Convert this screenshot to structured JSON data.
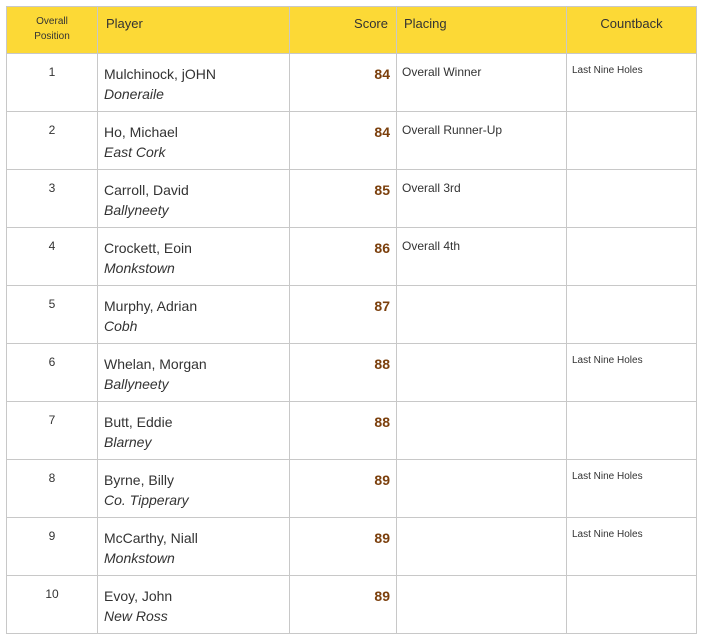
{
  "header": {
    "overall_line1": "Overall",
    "overall_line2": "Position",
    "player": "Player",
    "score": "Score",
    "placing": "Placing",
    "countback": "Countback"
  },
  "colors": {
    "header_bg": "#fcd936",
    "score_text": "#7b3f0c",
    "border": "#c8c8c8"
  },
  "rows": [
    {
      "pos": "1",
      "name": "Mulchinock, jOHN",
      "club": "Doneraile",
      "score": "84",
      "placing": "Overall Winner",
      "countback": "Last Nine Holes"
    },
    {
      "pos": "2",
      "name": "Ho, Michael",
      "club": "East Cork",
      "score": "84",
      "placing": "Overall Runner-Up",
      "countback": ""
    },
    {
      "pos": "3",
      "name": "Carroll, David",
      "club": "Ballyneety",
      "score": "85",
      "placing": "Overall 3rd",
      "countback": ""
    },
    {
      "pos": "4",
      "name": "Crockett, Eoin",
      "club": "Monkstown",
      "score": "86",
      "placing": "Overall 4th",
      "countback": ""
    },
    {
      "pos": "5",
      "name": "Murphy, Adrian",
      "club": "Cobh",
      "score": "87",
      "placing": "",
      "countback": ""
    },
    {
      "pos": "6",
      "name": "Whelan, Morgan",
      "club": "Ballyneety",
      "score": "88",
      "placing": "",
      "countback": "Last Nine Holes"
    },
    {
      "pos": "7",
      "name": "Butt, Eddie",
      "club": "Blarney",
      "score": "88",
      "placing": "",
      "countback": ""
    },
    {
      "pos": "8",
      "name": "Byrne, Billy",
      "club": "Co. Tipperary",
      "score": "89",
      "placing": "",
      "countback": "Last Nine Holes"
    },
    {
      "pos": "9",
      "name": "McCarthy, Niall",
      "club": "Monkstown",
      "score": "89",
      "placing": "",
      "countback": "Last Nine Holes"
    },
    {
      "pos": "10",
      "name": "Evoy, John",
      "club": "New Ross",
      "score": "89",
      "placing": "",
      "countback": ""
    }
  ]
}
